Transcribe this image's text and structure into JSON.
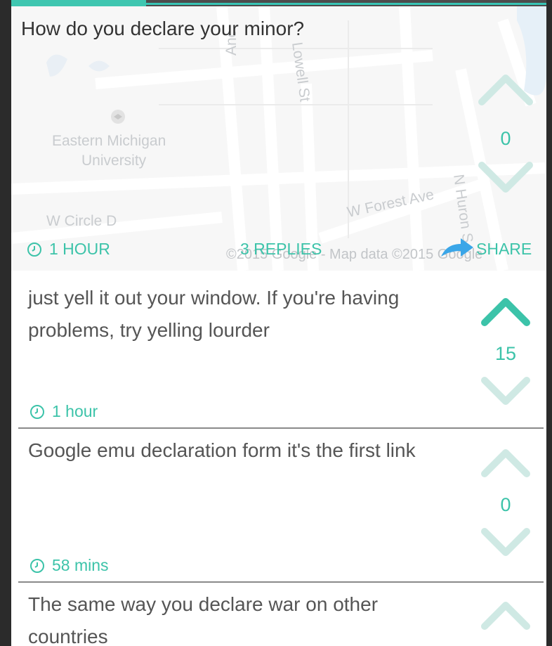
{
  "post": {
    "text": "How do you declare your minor?",
    "time": "1 HOUR",
    "replies": "3 REPLIES",
    "share": "SHARE",
    "votes": "0",
    "map": {
      "labels": [
        "Eastern Michigan",
        "University",
        "W Circle D",
        "W Forest Ave",
        "Lowell St",
        "N Huron S",
        "Anc"
      ],
      "credit": "©2015 Google - Map data ©2015 Google"
    }
  },
  "replies": [
    {
      "text": "just yell it out your window. If you're having problems, try yelling lourder",
      "time": "1 hour",
      "votes": "15"
    },
    {
      "text": "Google emu declaration form it's the first link",
      "time": "58 mins",
      "votes": "0"
    },
    {
      "text": "The same way you declare war on other countries",
      "time": "",
      "votes": ""
    }
  ],
  "colors": {
    "accent": "#3cc3a9",
    "upvote_active": "#3cc3a9",
    "vote_inactive": "#c9e7e2"
  },
  "icons": [
    "clock-icon",
    "upvote-icon",
    "downvote-icon",
    "share-arrow-icon",
    "university-marker-icon"
  ]
}
